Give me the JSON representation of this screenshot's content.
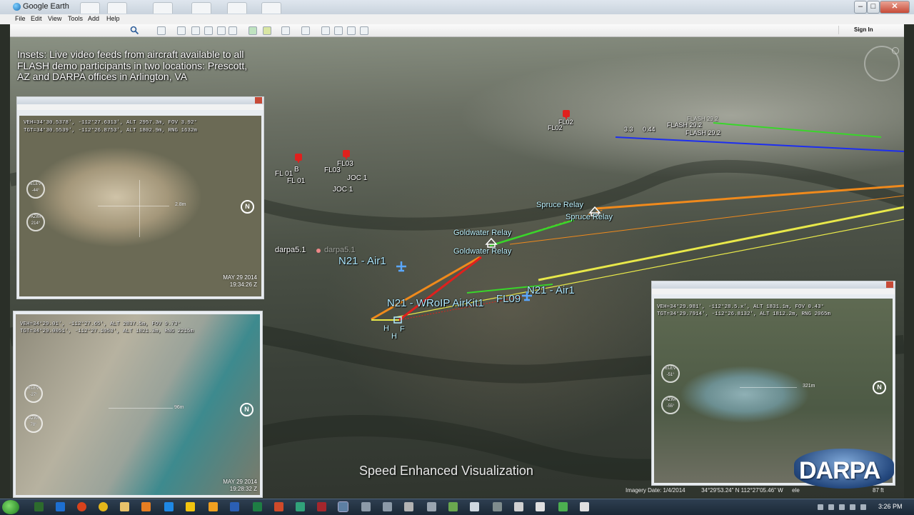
{
  "window": {
    "title": "Google Earth",
    "menu": [
      "File",
      "Edit",
      "View",
      "Tools",
      "Add",
      "Help"
    ],
    "sign_in": "Sign In",
    "controls": {
      "minimize": "–",
      "maximize": "□",
      "close": "✕"
    }
  },
  "overlay": {
    "insets_text": "Insets: Live video feeds from aircraft available to all FLASH demo participants in two locations: Prescott, AZ and DARPA offices in Arlington, VA",
    "speed_text": "Speed Enhanced Visualization",
    "logo": "DARPA"
  },
  "map_labels": {
    "fl01a": "FL 01",
    "fl01b": "FL 01",
    "b_tag": "B",
    "fl03a": "FL03",
    "fl03b": "FL03",
    "joc1a": "JOC 1",
    "joc1b": "JOC 1",
    "fl02a": "FL02",
    "fl02b": "FL02",
    "ghost_label": "FLASH 29.2",
    "flash_a": "FLASH 29.2",
    "flash_b": "FLASH 29.2",
    "small_a": "3.3",
    "small_b": "0.44",
    "spruce_a": "Spruce Relay",
    "spruce_b": "Spruce Relay",
    "goldwater_a": "Goldwater Relay",
    "goldwater_b": "Goldwater Relay",
    "darpa5a": "darpa5.1",
    "darpa5b": "darpa5.1",
    "n21_air1_a": "N21 - Air1",
    "n21_air1_b": "N21 - Air1",
    "n21_wroip": "N21 - WRoIP AirKit1",
    "fl09": "FL09",
    "h1": "H",
    "h2": "H",
    "f1": "F"
  },
  "insets": [
    {
      "hud_line1": "VEH=34°30.5378', -112°27.6313', ALT 2957.3m, FOV 3.92°",
      "hud_line2": "TGT=34°30.5539', -112°26.8753', ALT 1802.9m, RNG 1632m",
      "elev": "ELEV",
      "elev_val": "-44°",
      "azim": "AZIM",
      "azim_val": "214°",
      "n": "N",
      "range": "2.8m",
      "date": "MAY 29 2014",
      "time": "19:34:26 Z"
    },
    {
      "hud_line1": "VEH=34°29.01', -112°27.65', ALT 2837.5m, FOV 9.73°",
      "hud_line2": "TGT=34°29.0051', -112°27.1053', ALT 1821.3m, RNG 2215m",
      "elev": "ELEV",
      "elev_val": "-27°",
      "azim": "AZIM",
      "azim_val": "78°",
      "n": "N",
      "range": "96m",
      "date": "MAY 29 2014",
      "time": "19:28:32 Z"
    },
    {
      "hud_line1": "VEH=34°29.981', -112°28.5.x', ALT 1831.1m, FOV 0.43°",
      "hud_line2": "TGT=34°29.7914', -112°26.8132', ALT 1812.2m, RNG 2065m",
      "elev": "ELEV",
      "elev_val": "-51°",
      "azim": "AZIM",
      "azim_val": "-55°",
      "n": "N",
      "range": "321m"
    }
  ],
  "statusbar": {
    "imagery": "Imagery Date: 1/4/2014",
    "coords": "34°29'53.24\" N  112°27'05.46\" W",
    "elev_prefix": "ele",
    "eye_suffix": "87 ft"
  },
  "taskbar": {
    "clock": "3:26 PM"
  },
  "colors": {
    "orange_line": "#f08a1c",
    "green_line": "#39d62a",
    "blue_line": "#1d2ef0",
    "yellow_line": "#e8e84a",
    "red_line": "#e0201d",
    "marker_red": "#e0201d",
    "label_cyan": "#aee8ff"
  },
  "icons": [
    "globe-icon",
    "search-icon",
    "placemark-icon",
    "path-icon",
    "polygon-icon",
    "ruler-icon",
    "sun-icon",
    "planet-icon",
    "print-icon",
    "email-icon",
    "map-icon",
    "airplane-icon",
    "relay-icon",
    "compass-icon"
  ]
}
